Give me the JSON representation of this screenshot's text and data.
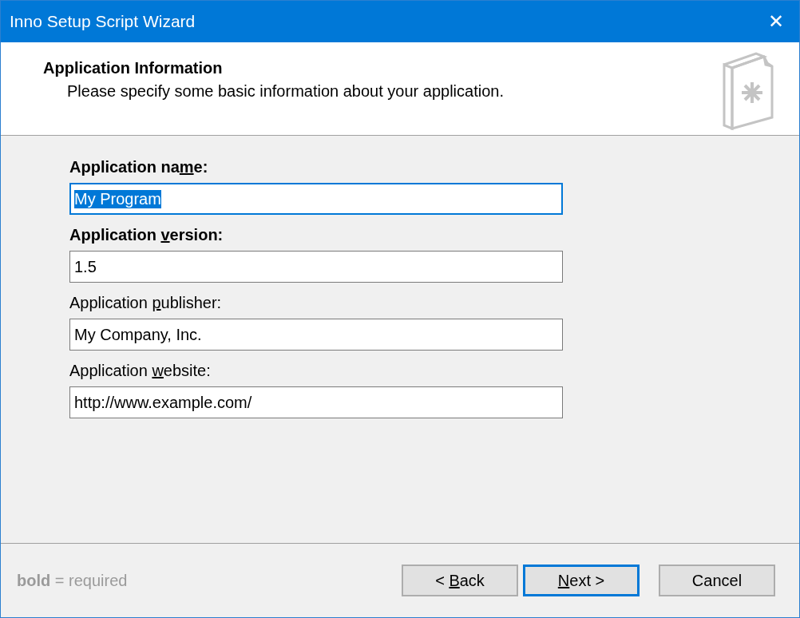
{
  "window": {
    "title": "Inno Setup Script Wizard",
    "close": "✕"
  },
  "header": {
    "title": "Application Information",
    "subtitle": "Please specify some basic information about your application."
  },
  "fields": [
    {
      "label": [
        {
          "text": "Application na",
          "underlined": false
        },
        {
          "text": "m",
          "underlined": true
        },
        {
          "text": "e:",
          "underlined": false
        }
      ],
      "required": true,
      "value": "My Program",
      "focused": true,
      "text_selected": true
    },
    {
      "label": [
        {
          "text": "Application ",
          "underlined": false
        },
        {
          "text": "v",
          "underlined": true
        },
        {
          "text": "ersion:",
          "underlined": false
        }
      ],
      "required": true,
      "value": "1.5",
      "focused": false,
      "text_selected": false
    },
    {
      "label": [
        {
          "text": "Application ",
          "underlined": false
        },
        {
          "text": "p",
          "underlined": true
        },
        {
          "text": "ublisher:",
          "underlined": false
        }
      ],
      "required": false,
      "value": "My Company, Inc.",
      "focused": false,
      "text_selected": false
    },
    {
      "label": [
        {
          "text": "Application ",
          "underlined": false
        },
        {
          "text": "w",
          "underlined": true
        },
        {
          "text": "ebsite:",
          "underlined": false
        }
      ],
      "required": false,
      "value": "http://www.example.com/",
      "focused": false,
      "text_selected": false
    }
  ],
  "legend": "**bold** = required",
  "buttons": [
    {
      "label": [
        {
          "text": "< ",
          "underlined": false
        },
        {
          "text": "B",
          "underlined": true
        },
        {
          "text": "ack",
          "underlined": false
        }
      ],
      "default": false,
      "kind": "back"
    },
    {
      "label": [
        {
          "text": "N",
          "underlined": true
        },
        {
          "text": "ext >",
          "underlined": false
        }
      ],
      "default": true,
      "kind": "next"
    },
    {
      "label": [
        {
          "text": "Cancel",
          "underlined": false
        }
      ],
      "default": false,
      "kind": "cancel"
    }
  ]
}
